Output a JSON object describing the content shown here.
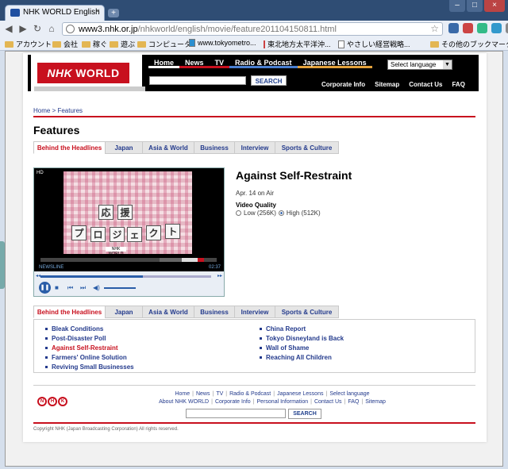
{
  "browser": {
    "tab_title": "NHK WORLD English",
    "tab_close": "×",
    "new_tab": "+",
    "window_buttons": [
      "–",
      "□",
      "×"
    ],
    "url_host": "www3.nhk.or.jp",
    "url_path": "/nhkworld/english/movie/feature201104150811.html",
    "bookmarks": [
      "アカウント",
      "会社",
      "稼ぐ",
      "遊ぶ",
      "コンピュータ",
      "www.tokyometro...",
      "東北地方太平洋沖...",
      "やさしい経営戦略...",
      "その他のブックマーク"
    ]
  },
  "header": {
    "logo": "NHK",
    "logo_word": "WORLD",
    "nav": [
      {
        "label": "Home",
        "color": "#ffffff"
      },
      {
        "label": "News",
        "color": "#c8101e"
      },
      {
        "label": "TV",
        "color": "#c8101e"
      },
      {
        "label": "Radio & Podcast",
        "color": "#4a7fd0"
      },
      {
        "label": "Japanese Lessons",
        "color": "#e3a23c"
      }
    ],
    "language_select": "Select language",
    "search_button": "SEARCH",
    "subnav": [
      "Corporate Info",
      "Sitemap",
      "Contact Us",
      "FAQ"
    ]
  },
  "breadcrumb": "Home > Features",
  "page_title": "Features",
  "category_tabs": [
    "Behind the Headlines",
    "Japan",
    "Asia & World",
    "Business",
    "Interview",
    "Sports & Culture"
  ],
  "player": {
    "hd_label": "HD",
    "video_text": [
      "応",
      "援",
      "プ",
      "ロ",
      "ジ",
      "ェ",
      "ク",
      "ト"
    ],
    "program": "NEWSLINE",
    "time": "02:37",
    "nhk_mini": "NHK WORLD",
    "seek_progress": 0.6
  },
  "video": {
    "title": "Against Self-Restraint",
    "air_date": "Apr. 14 on Air",
    "quality_label": "Video Quality",
    "quality_low": "Low (256K)",
    "quality_high": "High (512K)"
  },
  "related": {
    "left": [
      "Bleak Conditions",
      "Post-Disaster Poll",
      "Against Self-Restraint",
      "Farmers' Online Solution",
      "Reviving Small Businesses"
    ],
    "right": [
      "China Report",
      "Tokyo Disneyland is Back",
      "Wall of Shame",
      "Reaching All Children"
    ],
    "current": "Against Self-Restraint"
  },
  "footer": {
    "logo_letters": [
      "N",
      "H",
      "K"
    ],
    "links_row1": [
      "Home",
      "News",
      "TV",
      "Radio & Podcast",
      "Japanese Lessons",
      "Select language"
    ],
    "links_row2": [
      "About NHK WORLD",
      "Corporate Info",
      "Personal Information",
      "Contact Us",
      "FAQ",
      "Sitemap"
    ],
    "search_button": "SEARCH",
    "copyright": "Copyright NHK (Japan Broadcasting Corporation) All rights reserved."
  }
}
